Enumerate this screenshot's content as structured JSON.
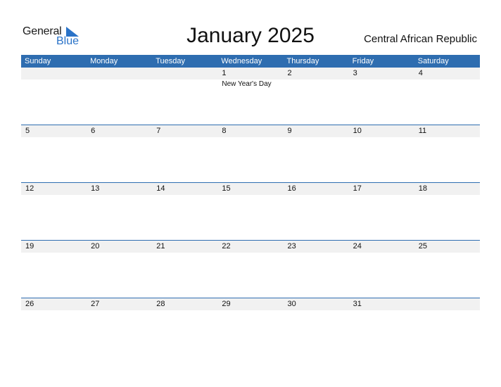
{
  "logo": {
    "general": "General",
    "blue": "Blue"
  },
  "title": "January 2025",
  "country": "Central African Republic",
  "colors": {
    "accent": "#2e6db0",
    "date_row_bg": "#f1f1f1"
  },
  "days": [
    "Sunday",
    "Monday",
    "Tuesday",
    "Wednesday",
    "Thursday",
    "Friday",
    "Saturday"
  ],
  "weeks": [
    {
      "dates": [
        "",
        "",
        "",
        "1",
        "2",
        "3",
        "4"
      ],
      "events": [
        "",
        "",
        "",
        "New Year's Day",
        "",
        "",
        ""
      ]
    },
    {
      "dates": [
        "5",
        "6",
        "7",
        "8",
        "9",
        "10",
        "11"
      ],
      "events": [
        "",
        "",
        "",
        "",
        "",
        "",
        ""
      ]
    },
    {
      "dates": [
        "12",
        "13",
        "14",
        "15",
        "16",
        "17",
        "18"
      ],
      "events": [
        "",
        "",
        "",
        "",
        "",
        "",
        ""
      ]
    },
    {
      "dates": [
        "19",
        "20",
        "21",
        "22",
        "23",
        "24",
        "25"
      ],
      "events": [
        "",
        "",
        "",
        "",
        "",
        "",
        ""
      ]
    },
    {
      "dates": [
        "26",
        "27",
        "28",
        "29",
        "30",
        "31",
        ""
      ],
      "events": [
        "",
        "",
        "",
        "",
        "",
        "",
        ""
      ]
    }
  ]
}
